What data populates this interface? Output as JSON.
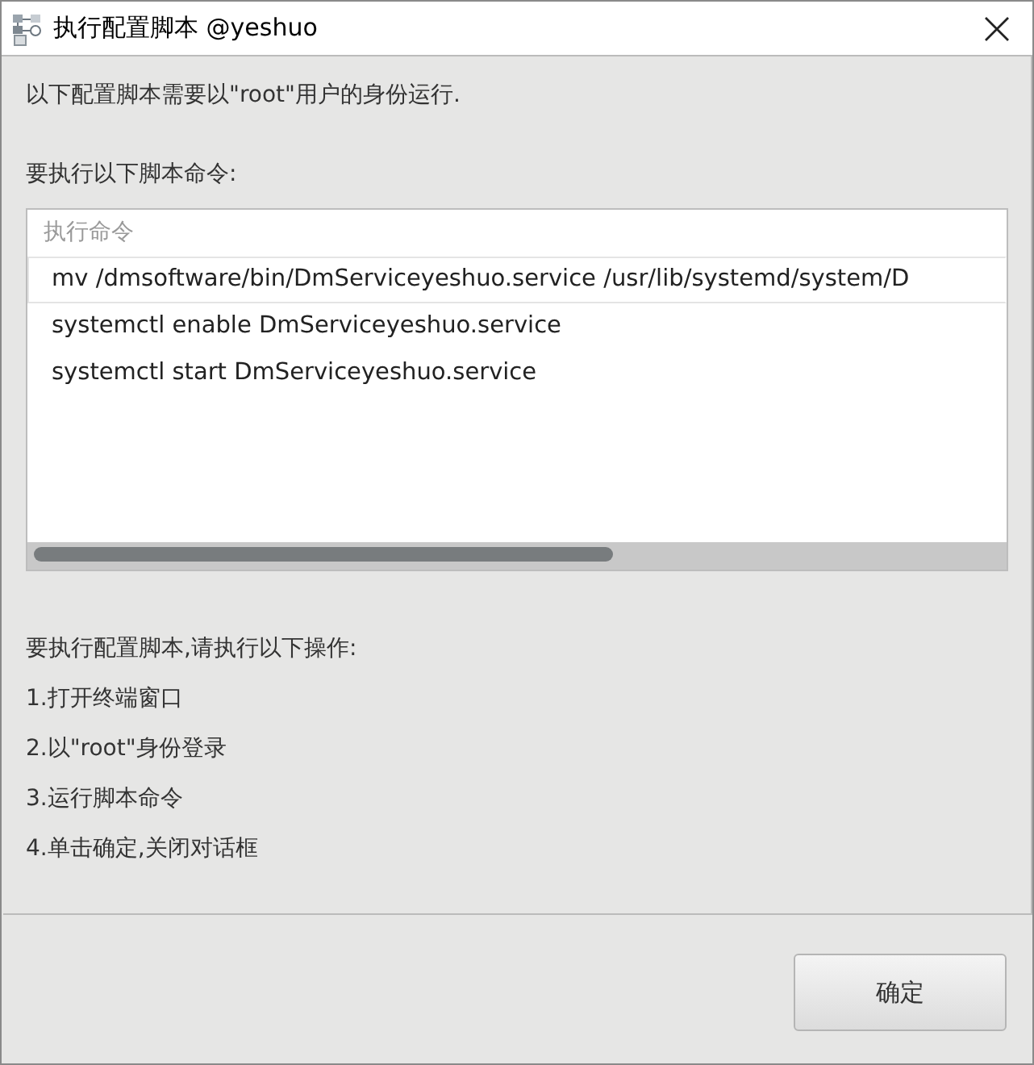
{
  "window": {
    "title": "执行配置脚本 @yeshuo"
  },
  "intro": "以下配置脚本需要以\"root\"用户的身份运行.",
  "commands_label": "要执行以下脚本命令:",
  "commands_table": {
    "column": "执行命令",
    "rows": [
      {
        "text": "mv /dmsoftware/bin/DmServiceyeshuo.service /usr/lib/systemd/system/D",
        "selected": true
      },
      {
        "text": "systemctl enable DmServiceyeshuo.service",
        "selected": false
      },
      {
        "text": "systemctl start DmServiceyeshuo.service",
        "selected": false
      }
    ]
  },
  "instructions": [
    "要执行配置脚本,请执行以下操作:",
    "1.打开终端窗口",
    "2.以\"root\"身份登录",
    "3.运行脚本命令",
    "4.单击确定,关闭对话框"
  ],
  "buttons": [
    "确定"
  ]
}
